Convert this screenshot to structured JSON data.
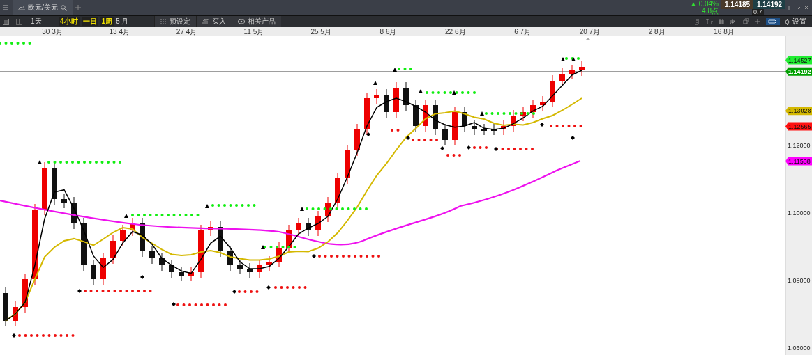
{
  "tab": {
    "title": "欧元/美元"
  },
  "toolbar": {
    "interval": "1天",
    "periods": [
      {
        "label": "4小时"
      },
      {
        "label": "一日"
      },
      {
        "label": "1周"
      }
    ],
    "range": "5 月",
    "buttons": [
      "预设定",
      "买入",
      "相关产品"
    ]
  },
  "quote": {
    "change": "▲ 0.04%",
    "points": "4.8点",
    "bid": "1.14185",
    "ask": "1.14192",
    "spread": "0.7"
  },
  "settings_label": "设置",
  "x_axis_labels": [
    "30 3月",
    "13 4月",
    "27 4月",
    "11 5月",
    "25 5月",
    "8 6月",
    "22 6月",
    "6 7月",
    "20 7月",
    "2 8月",
    "16 8月"
  ],
  "y_axis_labels": [
    "1.12000",
    "1.10000",
    "1.08000",
    "1.06000"
  ],
  "price_tags": [
    {
      "value": "1.14527",
      "color": "#22ee33"
    },
    {
      "value": "1.14192",
      "color": "#00a000"
    },
    {
      "value": "1.13028",
      "color": "#d4b800"
    },
    {
      "value": "1.12565",
      "color": "#ff1111"
    },
    {
      "value": "1.11538",
      "color": "#ff00ff"
    }
  ]
}
